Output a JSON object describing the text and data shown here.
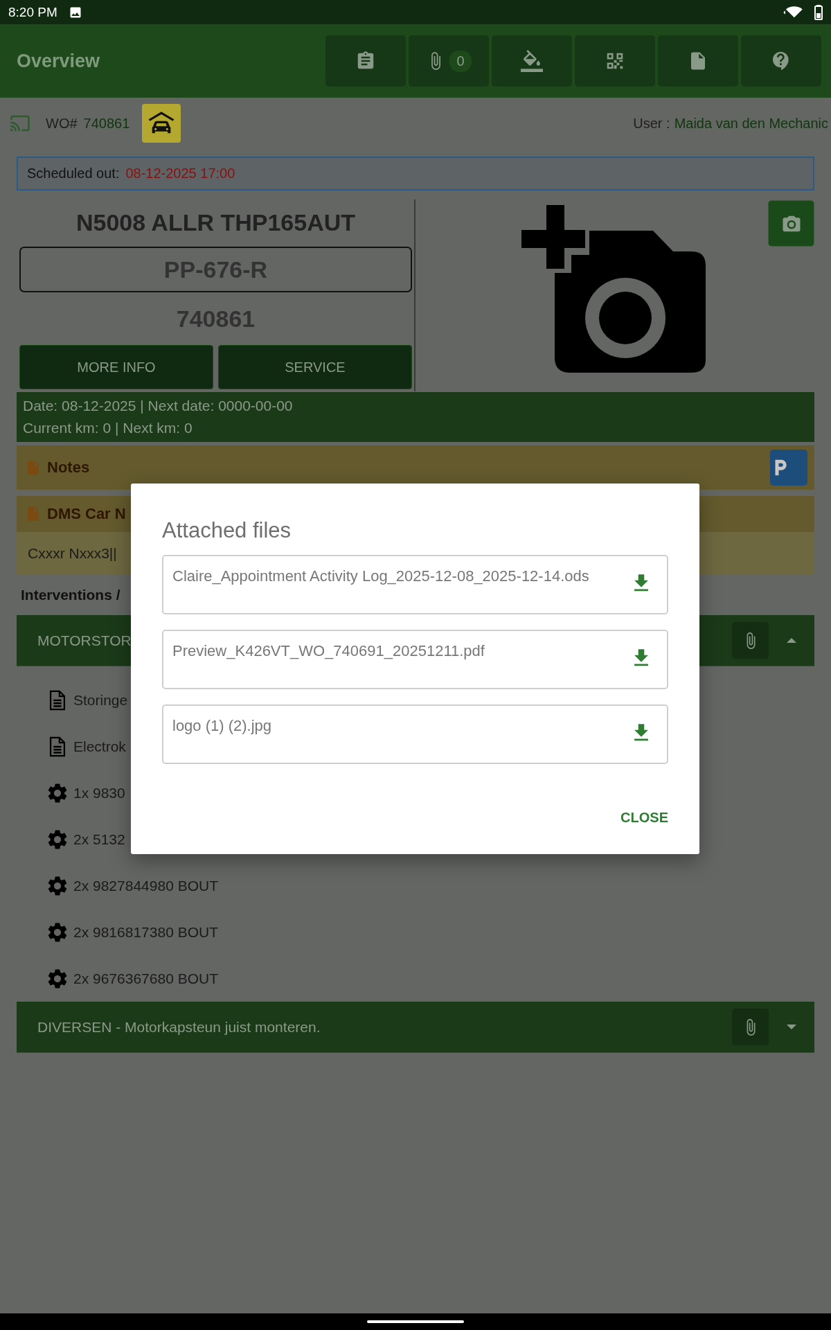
{
  "status_bar": {
    "time": "8:20 PM"
  },
  "app_bar": {
    "title": "Overview",
    "actions": [
      {
        "kind": "clipboard"
      },
      {
        "kind": "attachments",
        "badge": "0"
      },
      {
        "kind": "paint"
      },
      {
        "kind": "qr"
      },
      {
        "kind": "document"
      },
      {
        "kind": "help"
      }
    ]
  },
  "work_order": {
    "label": "WO#",
    "number": "740861",
    "user_label": "User :",
    "user_name": "Maida van den Mechanic"
  },
  "scheduled_out": {
    "label": "Scheduled out:",
    "value": "08-12-2025 17:00"
  },
  "vehicle": {
    "model": "N5008 ALLR THP165AUT",
    "plate": "PP-676-R",
    "number": "740861",
    "buttons": [
      "MORE INFO",
      "SERVICE"
    ]
  },
  "dates": [
    "Date: 08-12-2025 | Next date: 0000-00-00",
    "Current km: 0 | Next km: 0"
  ],
  "notes": {
    "title": "Notes"
  },
  "dms": {
    "title": "DMS Car N",
    "text": "Cxxxr Nxxx3||"
  },
  "interventions": {
    "title": "Interventions /",
    "groups": [
      {
        "title": "MOTORSTOR",
        "expanded": true,
        "items": [
          {
            "kind": "document",
            "text": "Storinge"
          },
          {
            "kind": "document",
            "text": "Electrok"
          },
          {
            "kind": "part",
            "text": "1x 9830"
          },
          {
            "kind": "part",
            "text": "2x 5132"
          },
          {
            "kind": "part",
            "text": "2x 9827844980 BOUT"
          },
          {
            "kind": "part",
            "text": "2x 9816817380 BOUT"
          },
          {
            "kind": "part",
            "text": "2x 9676367680 BOUT"
          }
        ]
      },
      {
        "title": "DIVERSEN - Motorkapsteun juist monteren.",
        "expanded": false
      }
    ]
  },
  "dialog": {
    "title": "Attached files",
    "files": [
      "Claire_Appointment Activity Log_2025-12-08_2025-12-14.ods",
      "Preview_K426VT_WO_740691_20251211.pdf",
      "logo (1) (2).jpg"
    ],
    "close": "CLOSE"
  }
}
